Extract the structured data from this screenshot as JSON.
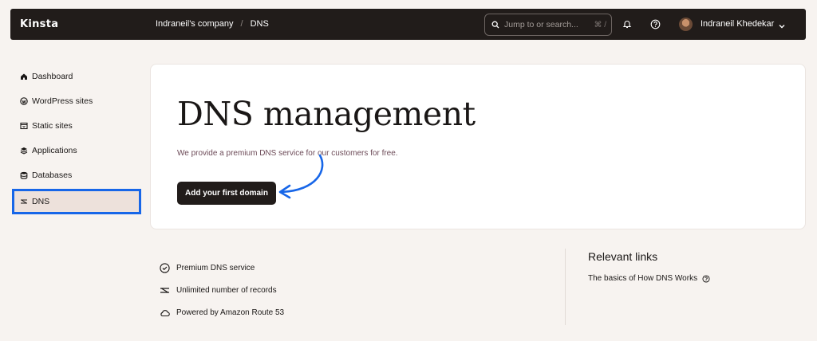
{
  "header": {
    "logo": "Kinsta",
    "breadcrumb": [
      "Indraneil's company",
      "DNS"
    ],
    "breadcrumb_separator": "/",
    "search_placeholder": "Jump to or search...",
    "search_shortcut": "⌘ /",
    "user_name": "Indraneil Khedekar",
    "icons": [
      "search-icon",
      "bell-icon",
      "help-icon",
      "chevron-down-icon"
    ]
  },
  "sidebar": {
    "items": [
      {
        "label": "Dashboard",
        "icon": "home-icon"
      },
      {
        "label": "WordPress sites",
        "icon": "wordpress-icon"
      },
      {
        "label": "Static sites",
        "icon": "static-sites-icon"
      },
      {
        "label": "Applications",
        "icon": "applications-icon"
      },
      {
        "label": "Databases",
        "icon": "database-icon"
      },
      {
        "label": "DNS",
        "icon": "dns-icon",
        "active": true
      }
    ]
  },
  "main": {
    "title": "DNS management",
    "subtitle": "We provide a premium DNS service for our customers for free.",
    "cta_label": "Add your first domain",
    "features": [
      {
        "label": "Premium DNS service",
        "icon": "check-circle-icon"
      },
      {
        "label": "Unlimited number of records",
        "icon": "dns-icon"
      },
      {
        "label": "Powered by Amazon Route 53",
        "icon": "cloud-icon"
      }
    ],
    "links_title": "Relevant links",
    "links": [
      {
        "label": "The basics of How DNS Works",
        "icon": "help-icon"
      }
    ]
  },
  "colors": {
    "topbar": "#211c1a",
    "background": "#f7f3f0",
    "highlight": "#1766e8",
    "active_item": "#ede1db"
  }
}
